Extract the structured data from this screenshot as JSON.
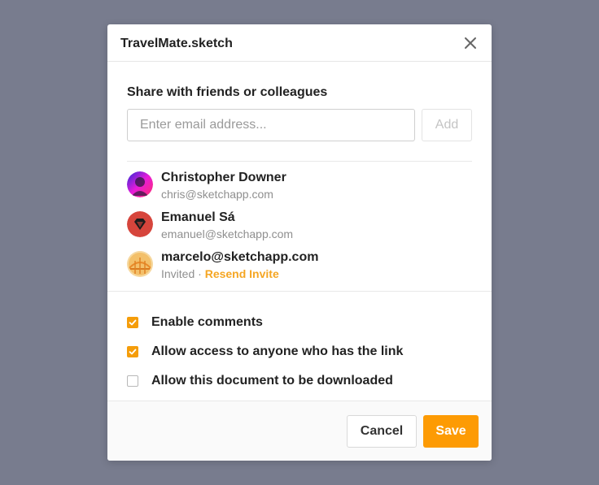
{
  "dialog": {
    "title": "TravelMate.sketch",
    "close_icon": "close-icon"
  },
  "share": {
    "heading": "Share with friends or colleagues",
    "email_placeholder": "Enter email address...",
    "email_value": "",
    "add_label": "Add"
  },
  "people": [
    {
      "name": "Christopher Downer",
      "email": "chris@sketchapp.com",
      "avatar": "avatar-christopher"
    },
    {
      "name": "Emanuel Sá",
      "email": "emanuel@sketchapp.com",
      "avatar": "avatar-emanuel"
    },
    {
      "name": "marcelo@sketchapp.com",
      "status": "Invited",
      "separator": " · ",
      "action": "Resend Invite",
      "avatar": "avatar-marcelo"
    }
  ],
  "options": [
    {
      "label": "Enable comments",
      "checked": true
    },
    {
      "label": "Allow access to anyone who has the link",
      "checked": true
    },
    {
      "label": "Allow this document to be downloaded",
      "checked": false
    }
  ],
  "footer": {
    "cancel_label": "Cancel",
    "save_label": "Save"
  },
  "colors": {
    "accent": "#fd9b04",
    "link": "#f5a623",
    "backdrop": "#787c8e"
  }
}
